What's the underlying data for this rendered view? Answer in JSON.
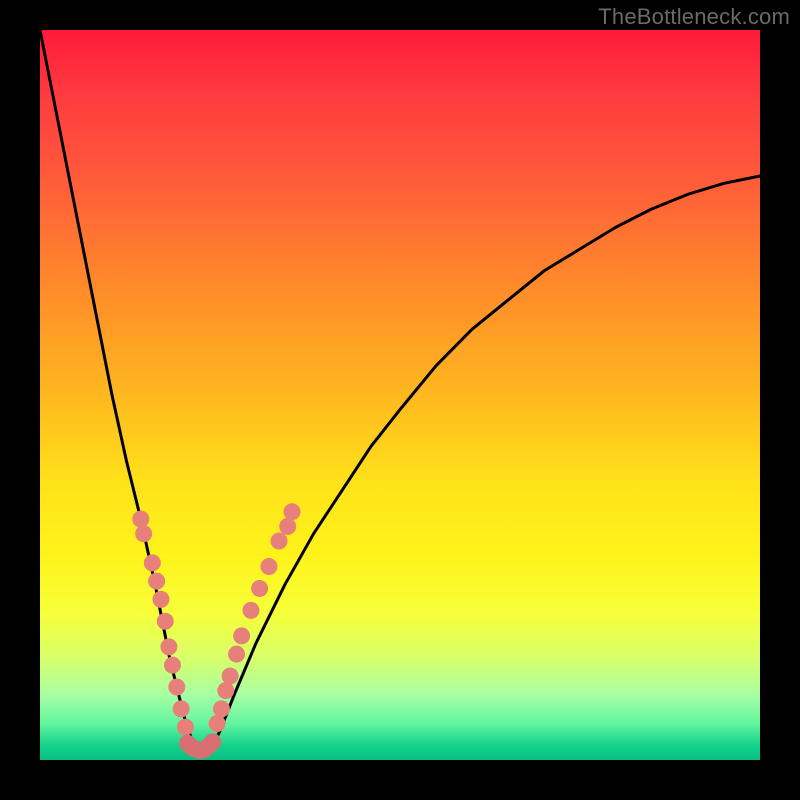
{
  "watermark": "TheBottleneck.com",
  "chart_data": {
    "type": "line",
    "title": "",
    "xlabel": "",
    "ylabel": "",
    "xlim": [
      0,
      100
    ],
    "ylim": [
      0,
      100
    ],
    "curve": {
      "name": "bottleneck-curve",
      "x": [
        0,
        2,
        4,
        6,
        8,
        10,
        12,
        14,
        16,
        18,
        19,
        20,
        21,
        22,
        23,
        24,
        25,
        27,
        30,
        34,
        38,
        42,
        46,
        50,
        55,
        60,
        65,
        70,
        75,
        80,
        85,
        90,
        95,
        100
      ],
      "y": [
        100,
        90,
        80,
        70,
        60,
        50,
        41,
        33,
        24,
        14,
        10,
        6,
        3,
        1.5,
        1.2,
        2,
        4,
        9,
        16,
        24,
        31,
        37,
        43,
        48,
        54,
        59,
        63,
        67,
        70,
        73,
        75.5,
        77.5,
        79,
        80
      ]
    },
    "dot_clusters": [
      {
        "name": "left-limb-dots",
        "color": "#e77f7a",
        "points": [
          {
            "x": 14.0,
            "y": 33.0
          },
          {
            "x": 14.4,
            "y": 31.0
          },
          {
            "x": 15.6,
            "y": 27.0
          },
          {
            "x": 16.2,
            "y": 24.5
          },
          {
            "x": 16.8,
            "y": 22.0
          },
          {
            "x": 17.4,
            "y": 19.0
          },
          {
            "x": 17.9,
            "y": 15.5
          },
          {
            "x": 18.4,
            "y": 13.0
          },
          {
            "x": 19.0,
            "y": 10.0
          },
          {
            "x": 19.6,
            "y": 7.0
          },
          {
            "x": 20.2,
            "y": 4.5
          }
        ]
      },
      {
        "name": "floor-dots",
        "color": "#d96f72",
        "points": [
          {
            "x": 20.5,
            "y": 2.3
          },
          {
            "x": 21.0,
            "y": 1.8
          },
          {
            "x": 21.6,
            "y": 1.5
          },
          {
            "x": 22.2,
            "y": 1.3
          },
          {
            "x": 22.8,
            "y": 1.4
          },
          {
            "x": 23.4,
            "y": 1.9
          },
          {
            "x": 24.0,
            "y": 2.5
          }
        ]
      },
      {
        "name": "right-limb-dots",
        "color": "#e77f7a",
        "points": [
          {
            "x": 24.6,
            "y": 5.0
          },
          {
            "x": 25.2,
            "y": 7.0
          },
          {
            "x": 25.8,
            "y": 9.5
          },
          {
            "x": 26.4,
            "y": 11.5
          },
          {
            "x": 27.3,
            "y": 14.5
          },
          {
            "x": 28.0,
            "y": 17.0
          },
          {
            "x": 29.3,
            "y": 20.5
          },
          {
            "x": 30.5,
            "y": 23.5
          },
          {
            "x": 31.8,
            "y": 26.5
          },
          {
            "x": 33.2,
            "y": 30.0
          },
          {
            "x": 34.4,
            "y": 32.0
          },
          {
            "x": 35.0,
            "y": 34.0
          }
        ]
      }
    ]
  }
}
